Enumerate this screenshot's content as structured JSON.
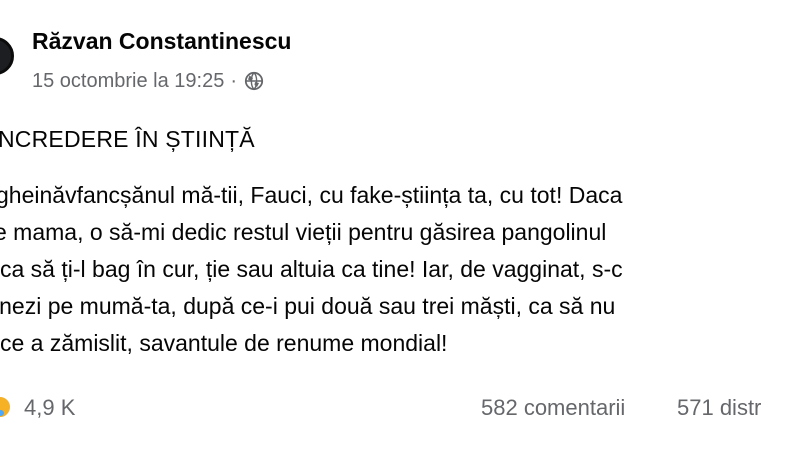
{
  "post": {
    "author": "Răzvan Constantinescu",
    "timestamp": "15 octombrie la 19:25",
    "separator": "·",
    "audience_icon": "globe-icon",
    "title": "NCREDERE ÎN ȘTIINȚĂ",
    "body_lines": [
      "gheinăvfancșănul mă-tii, Fauci, cu fake-știința ta, cu tot! Daca",
      "e mama, o să-mi dedic restul vieții pentru găsirea pangolinul",
      "ca să ți-l bag în cur, ție sau altuia ca tine! Iar, de vagginat, s-c",
      "inezi pe mumă-ta, după ce-i pui două sau trei măști, ca să nu",
      "ce a zămislit, savantule de renume mondial!"
    ]
  },
  "footer": {
    "reaction_icon": "care-emoji-icon",
    "reaction_count": "4,9 K",
    "comments": "582 comentarii",
    "shares": "571 distr"
  },
  "colors": {
    "text": "#050505",
    "secondary_text": "#65676b",
    "background": "#ffffff"
  }
}
